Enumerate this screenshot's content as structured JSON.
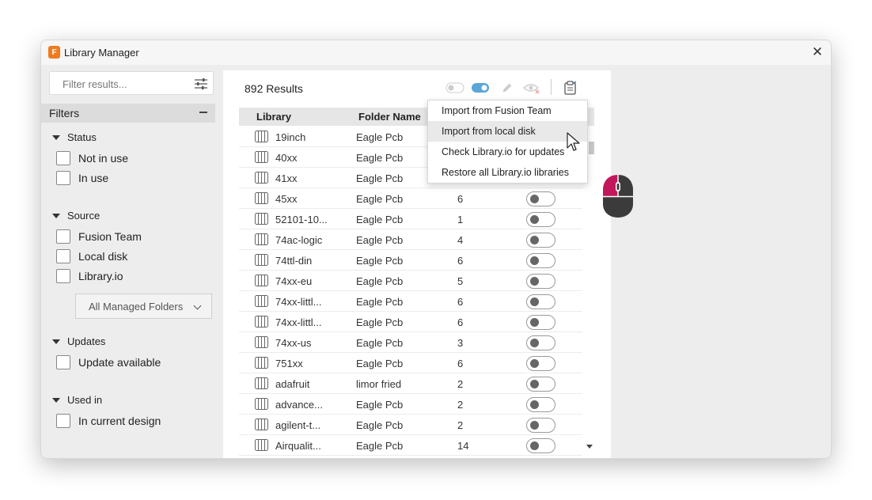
{
  "window": {
    "title": "Library Manager",
    "app_icon_letter": "F"
  },
  "left": {
    "filter_placeholder": "Filter results...",
    "filters_label": "Filters",
    "sections": {
      "status": {
        "title": "Status",
        "options": [
          "Not in use",
          "In use"
        ]
      },
      "source": {
        "title": "Source",
        "options": [
          "Fusion Team",
          "Local disk",
          "Library.io"
        ],
        "folders_dropdown": "All Managed Folders"
      },
      "updates": {
        "title": "Updates",
        "options": [
          "Update available"
        ]
      },
      "used_in": {
        "title": "Used in",
        "options": [
          "In current design"
        ]
      }
    }
  },
  "main": {
    "results_count": "892 Results",
    "columns": {
      "library": "Library",
      "folder": "Folder Name"
    },
    "rows": [
      {
        "library": "19inch",
        "folder": "Eagle Pcb",
        "count": ""
      },
      {
        "library": "40xx",
        "folder": "Eagle Pcb",
        "count": ""
      },
      {
        "library": "41xx",
        "folder": "Eagle Pcb",
        "count": ""
      },
      {
        "library": "45xx",
        "folder": "Eagle Pcb",
        "count": "6"
      },
      {
        "library": "52101-10...",
        "folder": "Eagle Pcb",
        "count": "1"
      },
      {
        "library": "74ac-logic",
        "folder": "Eagle Pcb",
        "count": "4"
      },
      {
        "library": "74ttl-din",
        "folder": "Eagle Pcb",
        "count": "6"
      },
      {
        "library": "74xx-eu",
        "folder": "Eagle Pcb",
        "count": "5"
      },
      {
        "library": "74xx-littl...",
        "folder": "Eagle Pcb",
        "count": "6"
      },
      {
        "library": "74xx-littl...",
        "folder": "Eagle Pcb",
        "count": "6"
      },
      {
        "library": "74xx-us",
        "folder": "Eagle Pcb",
        "count": "3"
      },
      {
        "library": "751xx",
        "folder": "Eagle Pcb",
        "count": "6"
      },
      {
        "library": "adafruit",
        "folder": "limor fried",
        "count": "2"
      },
      {
        "library": "advance...",
        "folder": "Eagle Pcb",
        "count": "2"
      },
      {
        "library": "agilent-t...",
        "folder": "Eagle Pcb",
        "count": "2"
      },
      {
        "library": "Airqualit...",
        "folder": "Eagle Pcb",
        "count": "14"
      }
    ]
  },
  "menu": {
    "items": [
      "Import from Fusion Team",
      "Import from local disk",
      "Check Library.io for updates",
      "Restore all Library.io libraries"
    ]
  },
  "colors": {
    "accent_toggle": "#5aa6d8",
    "mouse_highlight": "#c2185b",
    "app_icon": "#f07a1c"
  },
  "icons": [
    "sliders-icon",
    "minus-icon",
    "toggle-off-icon",
    "toggle-on-icon",
    "pencil-icon",
    "eye-hide-icon",
    "clipboard-icon",
    "library-icon",
    "mouse-left-click-icon",
    "pointer-cursor-icon"
  ]
}
